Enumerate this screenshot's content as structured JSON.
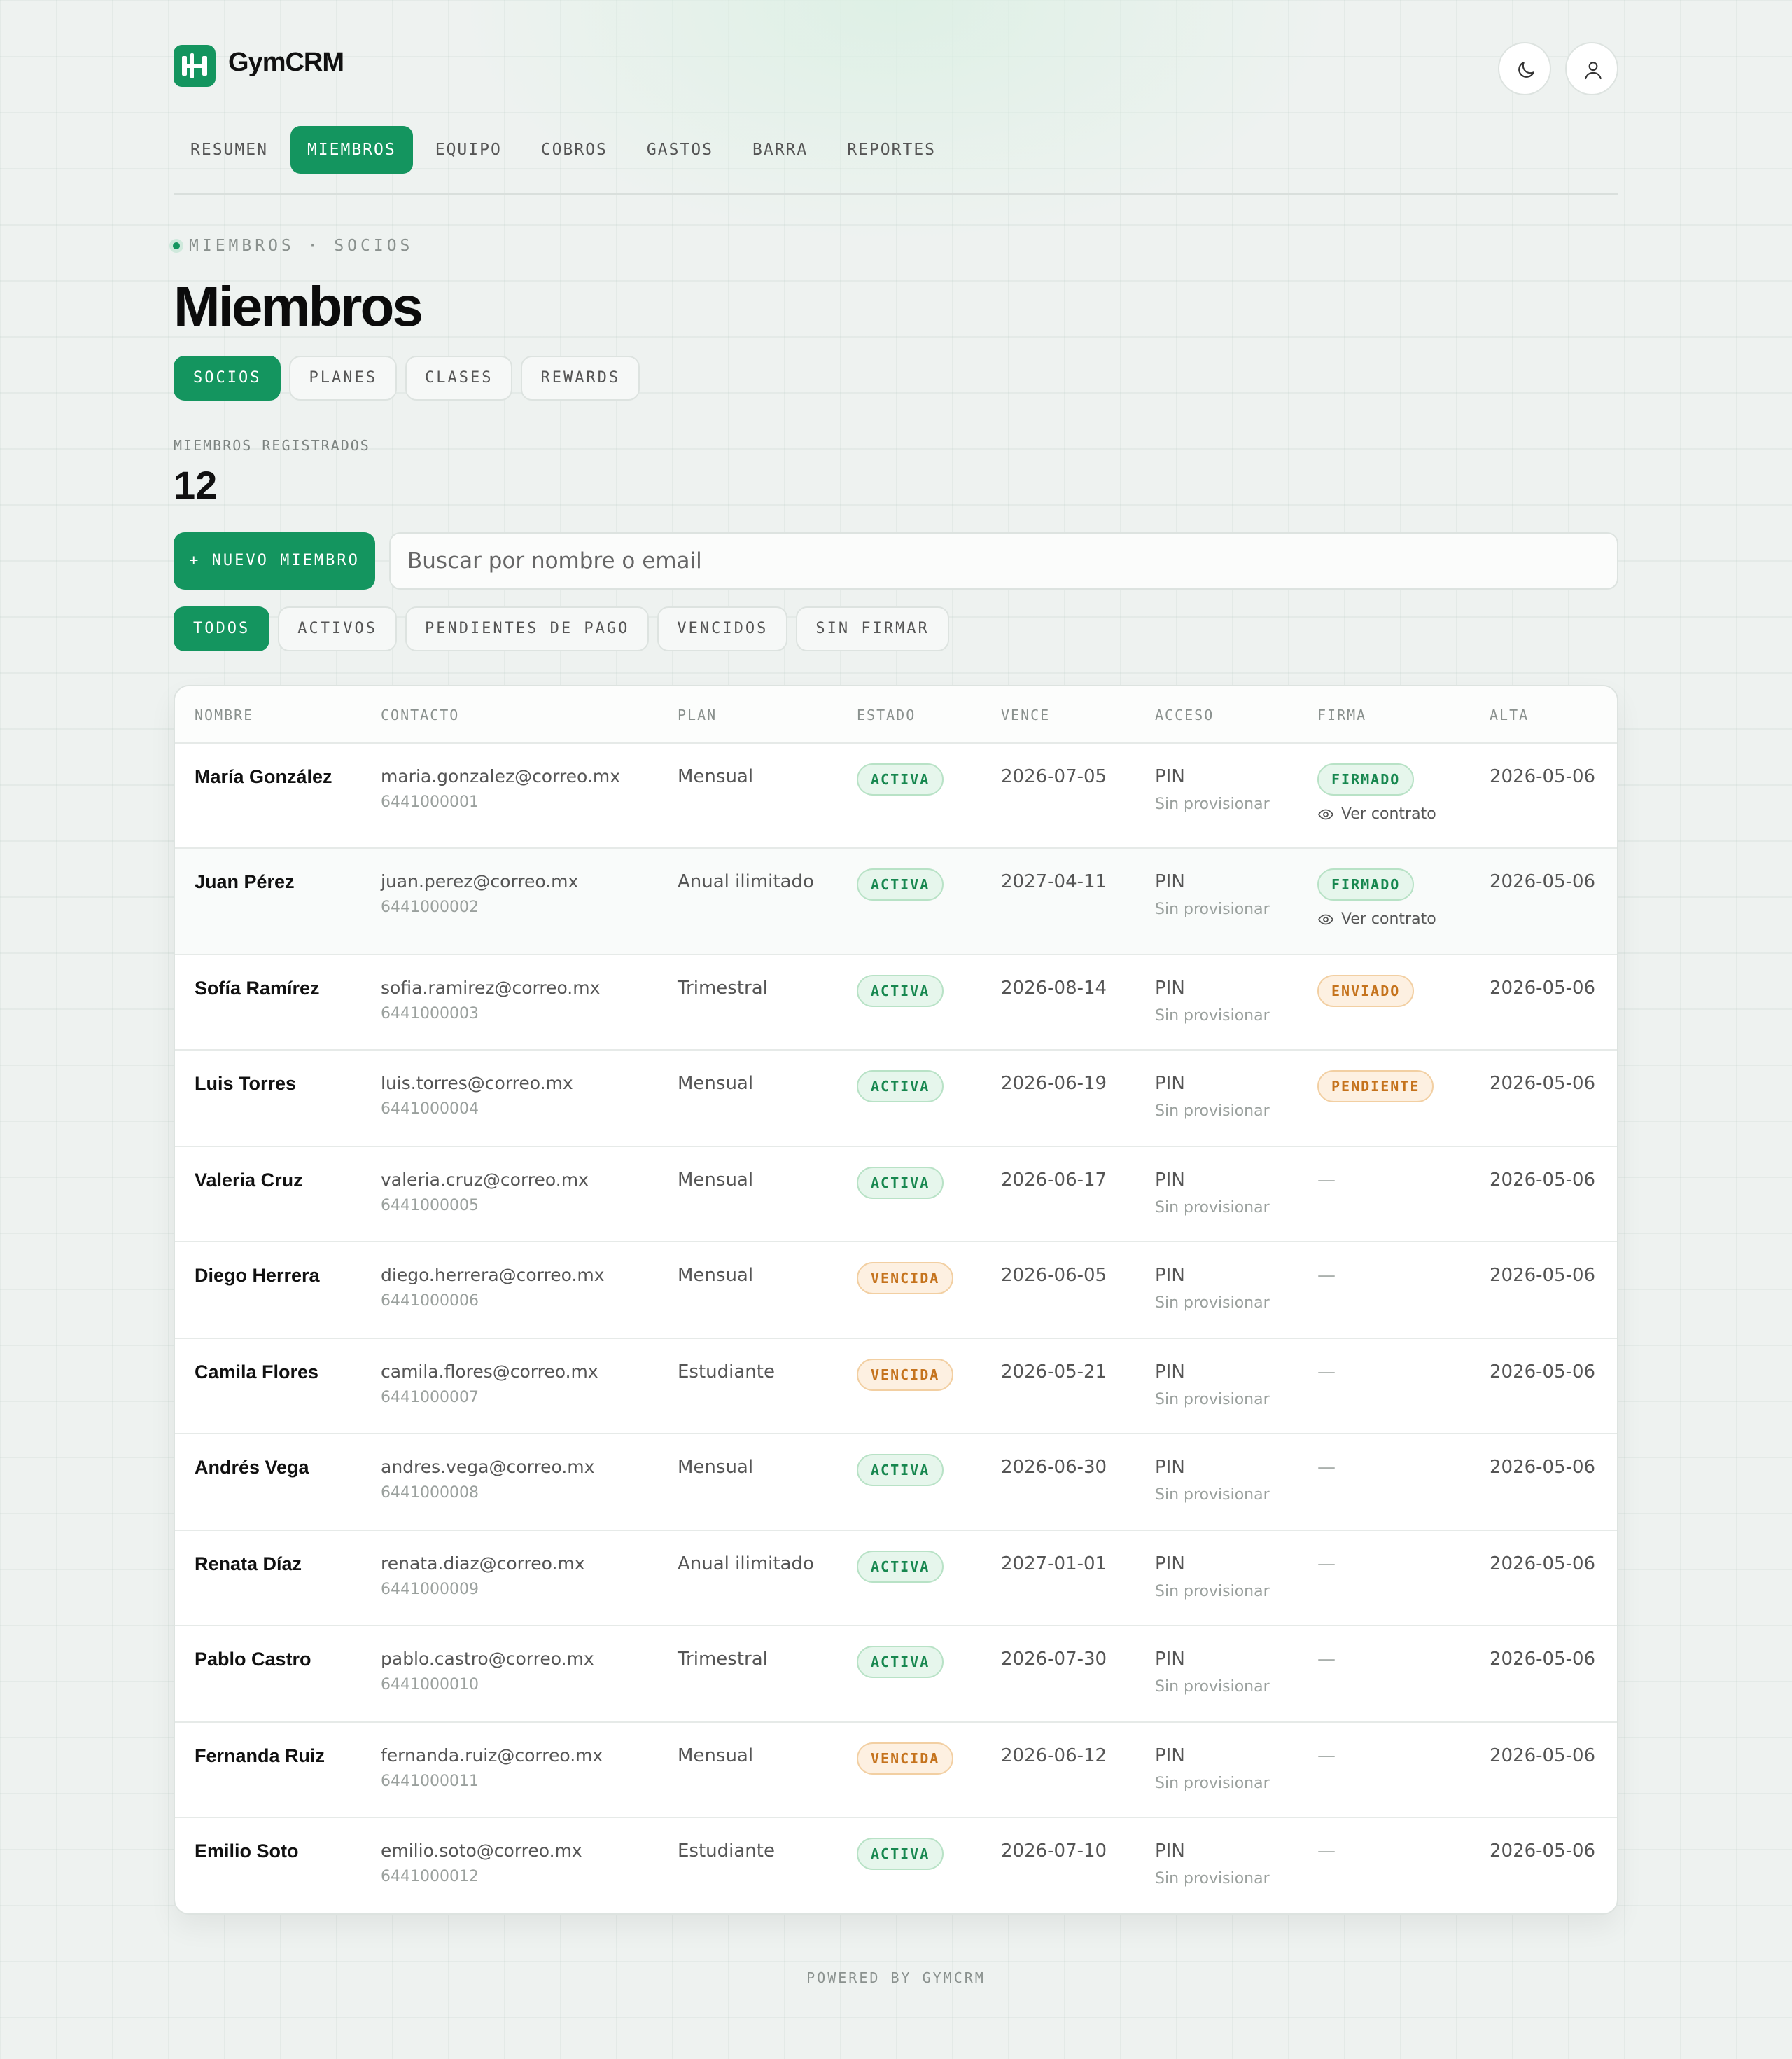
{
  "app": {
    "name": "GymCRM",
    "logo_icon": "dumbbell-icon",
    "accent": "#14955f"
  },
  "header_icons": {
    "theme": "moon-icon",
    "user": "user-icon"
  },
  "nav": {
    "items": [
      {
        "label": "RESUMEN",
        "active": false
      },
      {
        "label": "MIEMBROS",
        "active": true
      },
      {
        "label": "EQUIPO",
        "active": false
      },
      {
        "label": "COBROS",
        "active": false
      },
      {
        "label": "GASTOS",
        "active": false
      },
      {
        "label": "BARRA",
        "active": false
      },
      {
        "label": "REPORTES",
        "active": false
      }
    ]
  },
  "breadcrumb": "MIEMBROS · SOCIOS",
  "page_title": "Miembros",
  "subtabs": [
    {
      "label": "SOCIOS",
      "active": true
    },
    {
      "label": "PLANES",
      "active": false
    },
    {
      "label": "CLASES",
      "active": false
    },
    {
      "label": "REWARDS",
      "active": false
    }
  ],
  "stats": {
    "label": "MIEMBROS REGISTRADOS",
    "value": "12"
  },
  "new_member_button": "+ NUEVO MIEMBRO",
  "search": {
    "placeholder": "Buscar por nombre o email",
    "value": ""
  },
  "filters": [
    {
      "label": "TODOS",
      "active": true
    },
    {
      "label": "ACTIVOS",
      "active": false
    },
    {
      "label": "PENDIENTES DE PAGO",
      "active": false
    },
    {
      "label": "VENCIDOS",
      "active": false
    },
    {
      "label": "SIN FIRMAR",
      "active": false
    }
  ],
  "table": {
    "columns": [
      "NOMBRE",
      "CONTACTO",
      "PLAN",
      "ESTADO",
      "VENCE",
      "ACCESO",
      "FIRMA",
      "ALTA"
    ],
    "rows": [
      {
        "name": "María González",
        "email": "maria.gonzalez@correo.mx",
        "phone": "6441000001",
        "plan": "Mensual",
        "status": "ACTIVA",
        "status_color": "#17874f",
        "expires": "2026-07-05",
        "access": "PIN",
        "access_sub": "Sin provisionar",
        "signature": "FIRMADO",
        "signature_color": "#17874f",
        "contract_link": "Ver contrato",
        "joined": "2026-05-06"
      },
      {
        "name": "Juan Pérez",
        "email": "juan.perez@correo.mx",
        "phone": "6441000002",
        "plan": "Anual ilimitado",
        "status": "ACTIVA",
        "status_color": "#17874f",
        "expires": "2027-04-11",
        "access": "PIN",
        "access_sub": "Sin provisionar",
        "signature": "FIRMADO",
        "signature_color": "#17874f",
        "contract_link": "Ver contrato",
        "joined": "2026-05-06"
      },
      {
        "name": "Sofía Ramírez",
        "email": "sofia.ramirez@correo.mx",
        "phone": "6441000003",
        "plan": "Trimestral",
        "status": "ACTIVA",
        "status_color": "#17874f",
        "expires": "2026-08-14",
        "access": "PIN",
        "access_sub": "Sin provisionar",
        "signature": "ENVIADO",
        "signature_color": "#c5731d",
        "contract_link": "",
        "joined": "2026-05-06"
      },
      {
        "name": "Luis Torres",
        "email": "luis.torres@correo.mx",
        "phone": "6441000004",
        "plan": "Mensual",
        "status": "ACTIVA",
        "status_color": "#17874f",
        "expires": "2026-06-19",
        "access": "PIN",
        "access_sub": "Sin provisionar",
        "signature": "PENDIENTE",
        "signature_color": "#c5731d",
        "contract_link": "",
        "joined": "2026-05-06"
      },
      {
        "name": "Valeria Cruz",
        "email": "valeria.cruz@correo.mx",
        "phone": "6441000005",
        "plan": "Mensual",
        "status": "ACTIVA",
        "status_color": "#17874f",
        "expires": "2026-06-17",
        "access": "PIN",
        "access_sub": "Sin provisionar",
        "signature": "—",
        "signature_color": "",
        "contract_link": "",
        "joined": "2026-05-06"
      },
      {
        "name": "Diego Herrera",
        "email": "diego.herrera@correo.mx",
        "phone": "6441000006",
        "plan": "Mensual",
        "status": "VENCIDA",
        "status_color": "#c5731d",
        "expires": "2026-06-05",
        "access": "PIN",
        "access_sub": "Sin provisionar",
        "signature": "—",
        "signature_color": "",
        "contract_link": "",
        "joined": "2026-05-06"
      },
      {
        "name": "Camila Flores",
        "email": "camila.flores@correo.mx",
        "phone": "6441000007",
        "plan": "Estudiante",
        "status": "VENCIDA",
        "status_color": "#c5731d",
        "expires": "2026-05-21",
        "access": "PIN",
        "access_sub": "Sin provisionar",
        "signature": "—",
        "signature_color": "",
        "contract_link": "",
        "joined": "2026-05-06"
      },
      {
        "name": "Andrés Vega",
        "email": "andres.vega@correo.mx",
        "phone": "6441000008",
        "plan": "Mensual",
        "status": "ACTIVA",
        "status_color": "#17874f",
        "expires": "2026-06-30",
        "access": "PIN",
        "access_sub": "Sin provisionar",
        "signature": "—",
        "signature_color": "",
        "contract_link": "",
        "joined": "2026-05-06"
      },
      {
        "name": "Renata Díaz",
        "email": "renata.diaz@correo.mx",
        "phone": "6441000009",
        "plan": "Anual ilimitado",
        "status": "ACTIVA",
        "status_color": "#17874f",
        "expires": "2027-01-01",
        "access": "PIN",
        "access_sub": "Sin provisionar",
        "signature": "—",
        "signature_color": "",
        "contract_link": "",
        "joined": "2026-05-06"
      },
      {
        "name": "Pablo Castro",
        "email": "pablo.castro@correo.mx",
        "phone": "6441000010",
        "plan": "Trimestral",
        "status": "ACTIVA",
        "status_color": "#17874f",
        "expires": "2026-07-30",
        "access": "PIN",
        "access_sub": "Sin provisionar",
        "signature": "—",
        "signature_color": "",
        "contract_link": "",
        "joined": "2026-05-06"
      },
      {
        "name": "Fernanda Ruiz",
        "email": "fernanda.ruiz@correo.mx",
        "phone": "6441000011",
        "plan": "Mensual",
        "status": "VENCIDA",
        "status_color": "#c5731d",
        "expires": "2026-06-12",
        "access": "PIN",
        "access_sub": "Sin provisionar",
        "signature": "—",
        "signature_color": "",
        "contract_link": "",
        "joined": "2026-05-06"
      },
      {
        "name": "Emilio Soto",
        "email": "emilio.soto@correo.mx",
        "phone": "6441000012",
        "plan": "Estudiante",
        "status": "ACTIVA",
        "status_color": "#17874f",
        "expires": "2026-07-10",
        "access": "PIN",
        "access_sub": "Sin provisionar",
        "signature": "—",
        "signature_color": "",
        "contract_link": "",
        "joined": "2026-05-06"
      }
    ]
  },
  "footer": "POWERED BY GYMCRM"
}
